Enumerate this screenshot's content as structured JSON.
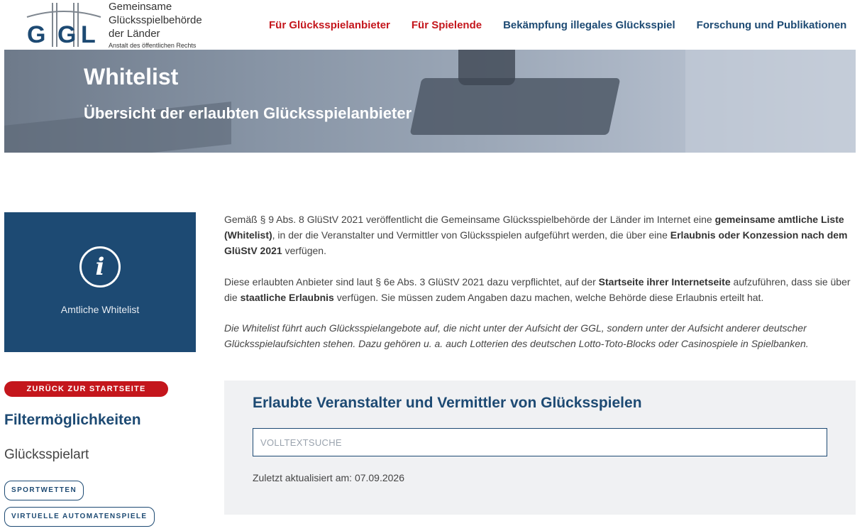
{
  "header": {
    "logo": {
      "letters": [
        "G",
        "G",
        "L"
      ],
      "line1": "Gemeinsame",
      "line2": "Glücksspielbehörde",
      "line3": "der Länder",
      "line4": "Anstalt des öffentlichen Rechts"
    },
    "nav": [
      {
        "label": "Für Glücksspielanbieter",
        "color": "#c4161c"
      },
      {
        "label": "Für Spielende",
        "color": "#c4161c"
      },
      {
        "label": "Bekämpfung illegales Glücksspiel",
        "color": "#1d4a73"
      },
      {
        "label": "Forschung und Publikationen",
        "color": "#1d4a73"
      }
    ]
  },
  "hero": {
    "title": "Whitelist",
    "subtitle": "Übersicht der erlaubten Glücksspielanbieter"
  },
  "sidebar": {
    "info_icon": "info-icon",
    "info_label": "Amtliche Whitelist",
    "back_button": "ZURÜCK ZUR STARTSEITE",
    "filter_title": "Filtermöglichkeiten",
    "filter_subtitle": "Glücksspielart",
    "filters": [
      "SPORTWETTEN",
      "VIRTUELLE AUTOMATENSPIELE"
    ]
  },
  "content": {
    "p1": {
      "a": "Gemäß § 9 Abs. 8 GlüStV 2021 veröffentlicht die Gemeinsame Glücksspielbehörde der Länder im Internet eine ",
      "b": "gemeinsame amtliche Liste (Whitelist)",
      "c": ", in der die Veranstalter und Vermittler von Glücksspielen aufgeführt werden, die über eine ",
      "d": "Erlaubnis oder Konzession nach dem GlüStV 2021",
      "e": " verfügen."
    },
    "p2": {
      "a": "Diese erlaubten Anbieter sind laut § 6e Abs. 3 GlüStV 2021 dazu verpflichtet, auf der ",
      "b": "Startseite ihrer Internetseite",
      "c": " aufzuführen, dass sie über die ",
      "d": "staatliche Erlaubnis",
      "e": " verfügen. Sie müssen zudem Angaben dazu machen, welche Behörde diese Erlaubnis erteilt hat."
    },
    "p3": "Die Whitelist führt auch Glücksspielangebote auf, die nicht unter der Aufsicht der GGL, sondern unter der Aufsicht anderer deutscher Glücksspielaufsichten stehen. Dazu gehören u. a. auch Lotterien des deutschen Lotto-Toto-Blocks oder Casinospiele in Spielbanken."
  },
  "search_panel": {
    "title": "Erlaubte Veranstalter und Vermittler von Glücksspielen",
    "search_placeholder": "VOLLTEXTSUCHE",
    "search_value": "",
    "updated": "Zuletzt aktualisiert am: 07.09.2026"
  },
  "colors": {
    "brand_blue": "#1d4a73",
    "brand_red": "#c4161c"
  }
}
